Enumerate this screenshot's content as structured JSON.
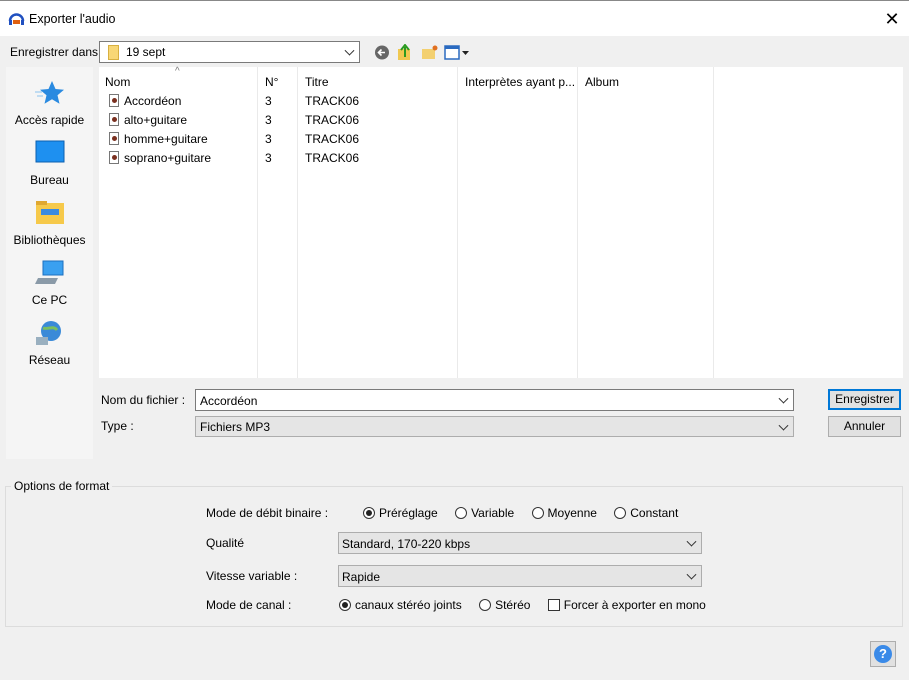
{
  "window": {
    "title": "Exporter l'audio",
    "close": "✕"
  },
  "location": {
    "label": "Enregistrer dans :",
    "value": "19 sept"
  },
  "toolbar": {
    "icons": [
      "back-icon",
      "up-folder-icon",
      "new-folder-icon",
      "view-menu-icon"
    ]
  },
  "places": [
    {
      "label": "Accès rapide",
      "icon": "star-icon"
    },
    {
      "label": "Bureau",
      "icon": "desktop-icon"
    },
    {
      "label": "Bibliothèques",
      "icon": "libraries-icon"
    },
    {
      "label": "Ce PC",
      "icon": "computer-icon"
    },
    {
      "label": "Réseau",
      "icon": "network-icon"
    }
  ],
  "columns": [
    "Nom",
    "N°",
    "Titre",
    "Interprètes ayant p...",
    "Album"
  ],
  "files": [
    {
      "name": "Accordéon",
      "num": "3",
      "title": "TRACK06"
    },
    {
      "name": "alto+guitare",
      "num": "3",
      "title": "TRACK06"
    },
    {
      "name": "homme+guitare",
      "num": "3",
      "title": "TRACK06"
    },
    {
      "name": "soprano+guitare",
      "num": "3",
      "title": "TRACK06"
    }
  ],
  "filename": {
    "label": "Nom du fichier :",
    "value": "Accordéon"
  },
  "type": {
    "label": "Type :",
    "value": "Fichiers MP3"
  },
  "buttons": {
    "save": "Enregistrer",
    "cancel": "Annuler",
    "help": "?"
  },
  "format": {
    "title": "Options de format",
    "bitrate_label": "Mode de débit binaire :",
    "bitrate_options": [
      "Préréglage",
      "Variable",
      "Moyenne",
      "Constant"
    ],
    "bitrate_selected": "Préréglage",
    "quality_label": "Qualité",
    "quality_value": "Standard, 170-220 kbps",
    "speed_label": "Vitesse variable :",
    "speed_value": "Rapide",
    "channel_label": "Mode de canal :",
    "channel_options": [
      "canaux stéréo joints",
      "Stéréo"
    ],
    "channel_selected": "canaux stéréo joints",
    "mono_label": "Forcer à exporter en mono",
    "mono_checked": false
  }
}
